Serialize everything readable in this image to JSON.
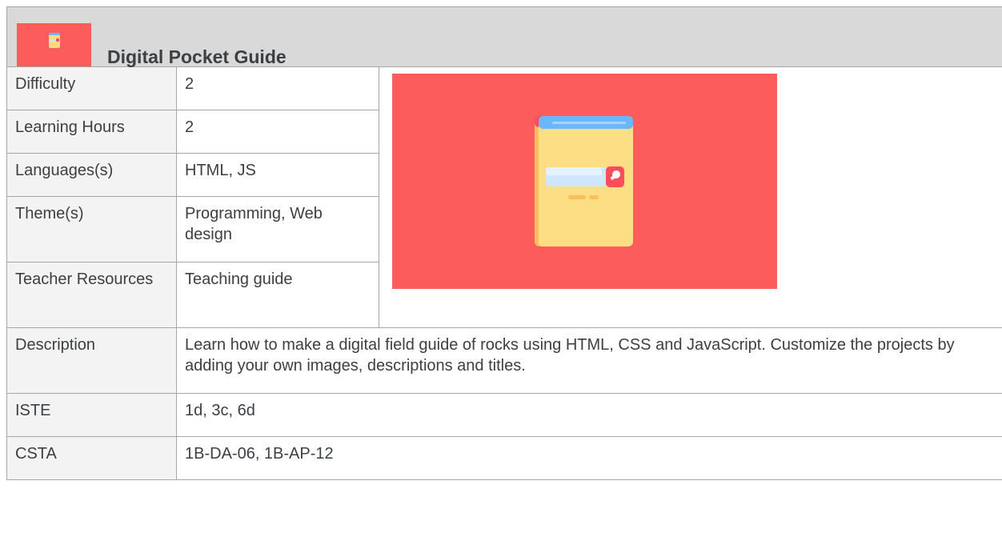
{
  "header": {
    "title": "Digital Pocket Guide",
    "logo_icon": "book-search-icon"
  },
  "rows": [
    {
      "label": "Difficulty",
      "value": "2"
    },
    {
      "label": "Learning Hours",
      "value": "2"
    },
    {
      "label": "Languages(s)",
      "value": "HTML, JS"
    },
    {
      "label": "Theme(s)",
      "value": "Programming, Web design"
    },
    {
      "label": "Teacher Resources",
      "value": "Teaching guide"
    }
  ],
  "details": [
    {
      "label": "Description",
      "value": "Learn how to make a digital field guide of rocks using HTML, CSS and JavaScript. Customize the projects by adding your own images, descriptions and titles."
    },
    {
      "label": "ISTE",
      "value": "1d, 3c, 6d"
    },
    {
      "label": "CSTA",
      "value": "1B-DA-06, 1B-AP-12"
    }
  ],
  "hero_image": {
    "icon": "book-search-icon",
    "background": "#fd5c5c"
  },
  "colors": {
    "header_bg": "#d9d9d9",
    "label_bg": "#f3f3f3",
    "accent": "#fd5c5c",
    "text": "#3c4043"
  }
}
